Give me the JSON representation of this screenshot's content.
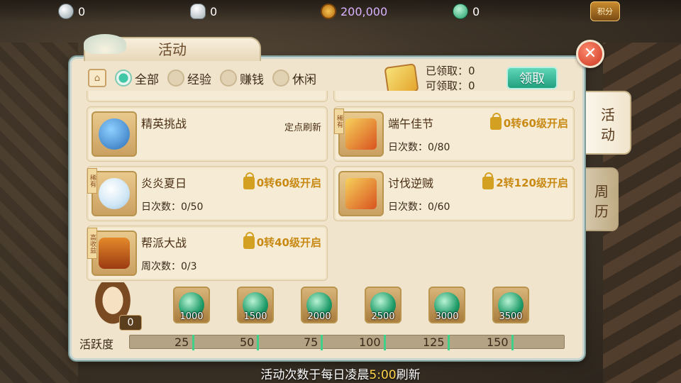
{
  "topbar": {
    "silver": "0",
    "ingot": "0",
    "coin": "200,000",
    "jade": "0",
    "score_label": "积分"
  },
  "panel": {
    "title": "活动",
    "close": "✕"
  },
  "filters": [
    {
      "label": "全部",
      "selected": true
    },
    {
      "label": "经验",
      "selected": false
    },
    {
      "label": "赚钱",
      "selected": false
    },
    {
      "label": "休闲",
      "selected": false
    }
  ],
  "claim": {
    "claimed": "已领取：0",
    "claimable": "可领取：0",
    "button": "领取"
  },
  "activities": [
    {
      "title": "精英挑战",
      "extra": "定点刷新",
      "count": "",
      "tag": "",
      "icon": "money-bag-icon"
    },
    {
      "title": "端午佳节",
      "lock": "0转60级开启",
      "count": "日次数：0/80",
      "tag": "稀有",
      "icon": "gift-box-icon"
    },
    {
      "title": "炎炎夏日",
      "lock": "0转60级开启",
      "count": "日次数：0/50",
      "tag": "稀有",
      "icon": "snowball-icon"
    },
    {
      "title": "讨伐逆贼",
      "lock": "2转120级开启",
      "count": "日次数：0/60",
      "tag": "",
      "icon": "gift-box-icon"
    },
    {
      "title": "帮派大战",
      "lock": "0转40级开启",
      "count": "周次数：0/3",
      "tag": "高收益",
      "icon": "pagoda-icon"
    }
  ],
  "side_tabs": [
    {
      "label": "活动",
      "active": true
    },
    {
      "label": "周历",
      "active": false
    }
  ],
  "rewards": {
    "activity_value": "0",
    "chests": [
      "1000",
      "1500",
      "2000",
      "2500",
      "3000",
      "3500"
    ],
    "activity_label": "活跃度",
    "milestones": [
      "25",
      "50",
      "75",
      "100",
      "125",
      "150"
    ],
    "progress": 0
  },
  "footer": {
    "pre": "活动次数于每日凌晨",
    "time": "5:00",
    "post": "刷新"
  }
}
